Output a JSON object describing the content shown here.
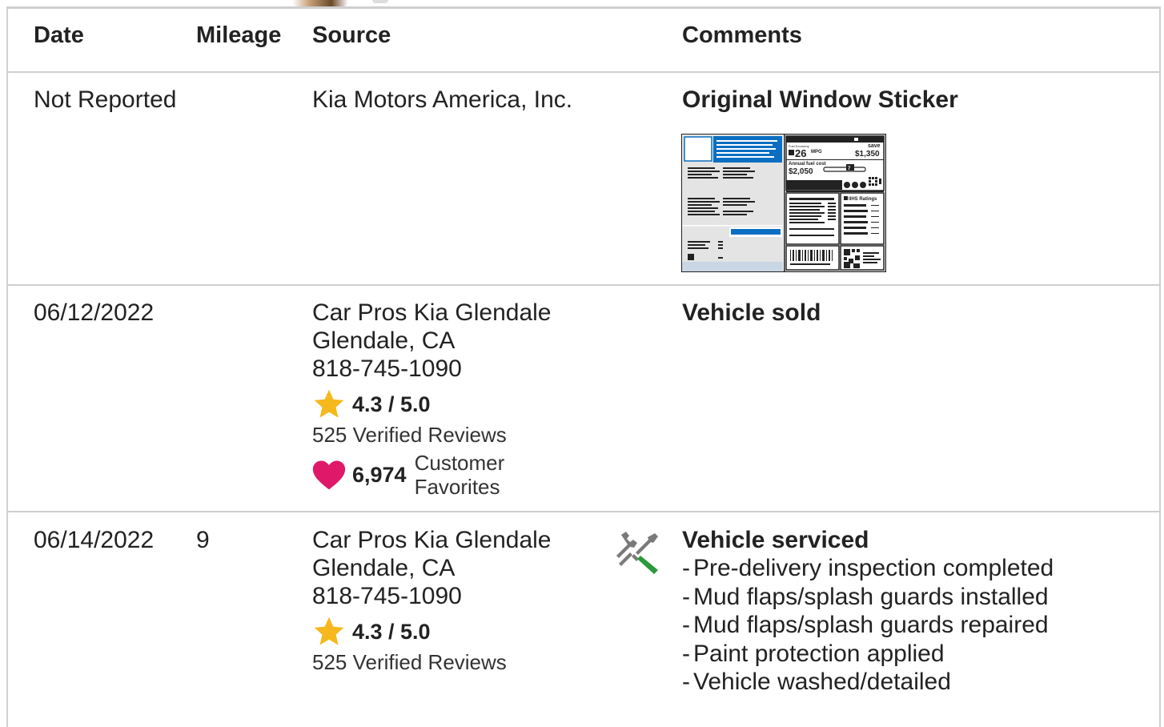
{
  "table": {
    "headers": {
      "date": "Date",
      "mileage": "Mileage",
      "source": "Source",
      "comments": "Comments"
    },
    "rows": [
      {
        "date": "Not Reported",
        "mileage": "",
        "source_name": "Kia Motors America, Inc.",
        "comment_title": "Original Window Sticker",
        "sticker": {
          "mpg": "26",
          "mpg_unit": "MPG",
          "save_label": "save",
          "save_amount": "$1,350",
          "annual_fuel_cost_label": "Annual fuel cost",
          "annual_fuel_cost": "$2,050",
          "scale_value": "7",
          "iihs_label": "IIHS Ratings"
        }
      },
      {
        "date": "06/12/2022",
        "mileage": "",
        "source_name": "Car Pros Kia Glendale",
        "source_city": "Glendale, CA",
        "source_phone": "818-745-1090",
        "rating": "4.3 / 5.0",
        "reviews": "525 Verified Reviews",
        "favorites_count": "6,974",
        "favorites_label_1": "Customer",
        "favorites_label_2": "Favorites",
        "comment_title": "Vehicle sold"
      },
      {
        "date": "06/14/2022",
        "mileage": "9",
        "source_name": "Car Pros Kia Glendale",
        "source_city": "Glendale, CA",
        "source_phone": "818-745-1090",
        "rating": "4.3 / 5.0",
        "reviews": "525 Verified Reviews",
        "comment_title": "Vehicle serviced",
        "comment_icon": "wrench-screwdriver-icon",
        "comment_items": [
          "Pre-delivery inspection completed",
          "Mud flaps/splash guards installed",
          "Mud flaps/splash guards repaired",
          "Paint protection applied",
          "Vehicle washed/detailed"
        ]
      }
    ]
  },
  "colors": {
    "star": "#f5b91d",
    "heart": "#e0186a",
    "border": "#cfcfcf",
    "sticker_blue": "#0a6fc2",
    "service_green": "#2a9a3a",
    "service_gray": "#7a7a7a"
  }
}
